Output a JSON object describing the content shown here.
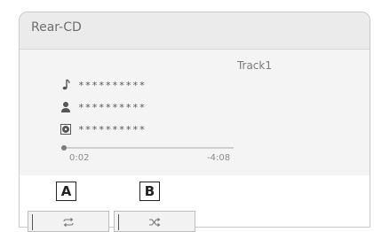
{
  "title": "Rear-CD",
  "track": "Track1",
  "rows": [
    {
      "icon": "music-note-icon",
      "text": "**********"
    },
    {
      "icon": "artist-icon",
      "text": "**********"
    },
    {
      "icon": "disc-icon",
      "text": "**********"
    }
  ],
  "progress": {
    "elapsed": "0:02",
    "remaining": "-4:08",
    "fraction": 0.008
  },
  "callouts": {
    "a": "A",
    "b": "B"
  },
  "buttons": {
    "repeat": "repeat-icon",
    "shuffle": "shuffle-icon"
  }
}
